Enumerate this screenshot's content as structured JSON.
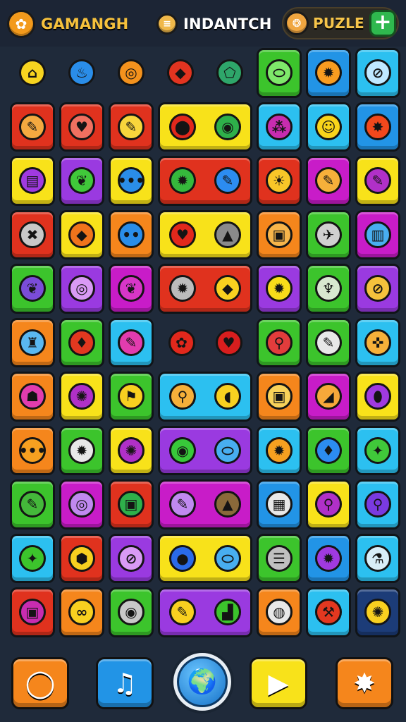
{
  "hud": {
    "item1": {
      "label": "GAMANGH",
      "icon": "gear-badge-icon",
      "color": "#f39a1c"
    },
    "item2": {
      "label": "INDANTCH",
      "icon": "coin-stack-icon",
      "color": "#f0b84a"
    },
    "item3": {
      "label": "PUZLE",
      "icon": "cookie-icon",
      "color": "#f0a640"
    },
    "plus": {
      "label": "+",
      "icon": "plus-icon"
    }
  },
  "palette": {
    "red": "#e0321e",
    "orange": "#f5861c",
    "yellow": "#f8e21a",
    "green": "#3cc42c",
    "blue": "#2294e6",
    "cyan": "#2cc0f0",
    "purple": "#9a3ae0",
    "magenta": "#c81cc8"
  },
  "tiles": [
    [
      {
        "bg": "bare",
        "icon": "house-icon",
        "g": "⌂",
        "c": "#f7d420"
      },
      {
        "bg": "bare",
        "icon": "flame-icon",
        "g": "♨",
        "c": "#2a8de8"
      },
      {
        "bg": "bare",
        "icon": "chat-bubble-icon",
        "g": "◎",
        "c": "#f4921d"
      },
      {
        "bg": "bare",
        "icon": "diamond-icon",
        "g": "◆",
        "c": "#e23420"
      },
      {
        "bg": "bare",
        "icon": "pentagon-icon",
        "g": "⬠",
        "c": "#2ea66a"
      },
      {
        "bg": "green",
        "icon": "capsule-icon",
        "g": "⬭",
        "c": "#7ee86a"
      },
      {
        "bg": "blue",
        "icon": "gear-icon",
        "g": "✹",
        "c": "#f89c20"
      },
      {
        "bg": "cyan",
        "icon": "compass-icon",
        "g": "⊘",
        "c": "#bfe8ff"
      }
    ],
    [
      {
        "bg": "red",
        "icon": "pin-icon",
        "g": "✎",
        "c": "#f4a940"
      },
      {
        "bg": "red",
        "icon": "heart-badge-icon",
        "g": "♥",
        "c": "#f07060"
      },
      {
        "bg": "red",
        "icon": "pencil-icon",
        "g": "✎",
        "c": "#f8d63c"
      },
      {
        "bg": "yellow",
        "span": 2,
        "icons": [
          {
            "icon": "location-pin-icon",
            "g": "⬤",
            "c": "#e2281c"
          },
          {
            "icon": "message-icon",
            "g": "◉",
            "c": "#2eb04a"
          }
        ]
      },
      {
        "bg": "cyan",
        "icon": "people-icon",
        "g": "⁂",
        "c": "#c82cb0"
      },
      {
        "bg": "cyan",
        "icon": "smile-icon",
        "g": "☺",
        "c": "#f8d41a"
      },
      {
        "bg": "blue",
        "icon": "starburst-icon",
        "g": "✸",
        "c": "#f2481c"
      }
    ],
    [
      {
        "bg": "yellow",
        "icon": "bandage-icon",
        "g": "▤",
        "c": "#a03ae0"
      },
      {
        "bg": "purple",
        "icon": "leaf-icon",
        "g": "❦",
        "c": "#40c83a"
      },
      {
        "bg": "yellow",
        "icon": "dots-icon",
        "g": "•••",
        "c": "#2a8de8"
      },
      {
        "bg": "red",
        "span": 2,
        "icons": [
          {
            "icon": "cog-icon",
            "g": "✹",
            "c": "#36b83c"
          },
          {
            "icon": "paint-tube-icon",
            "g": "✎",
            "c": "#2c8cf0"
          }
        ]
      },
      {
        "bg": "red",
        "icon": "robot-icon",
        "g": "☀",
        "c": "#f8c628"
      },
      {
        "bg": "magenta",
        "icon": "crayon-icon",
        "g": "✎",
        "c": "#f6b03a"
      },
      {
        "bg": "yellow",
        "icon": "marker-icon",
        "g": "✎",
        "c": "#b030c8"
      }
    ],
    [
      {
        "bg": "red",
        "icon": "cross-tools-icon",
        "g": "✖",
        "c": "#c8c8c8"
      },
      {
        "bg": "yellow",
        "icon": "eraser-icon",
        "g": "◆",
        "c": "#f0741c"
      },
      {
        "bg": "orange",
        "icon": "face-icon",
        "g": "••",
        "c": "#2a8de8"
      },
      {
        "bg": "yellow",
        "span": 2,
        "icons": [
          {
            "icon": "heart-icon",
            "g": "♥",
            "c": "#e2281c"
          },
          {
            "icon": "triangle-icon",
            "g": "▲",
            "c": "#8a8a8a"
          }
        ]
      },
      {
        "bg": "orange",
        "icon": "cassette-icon",
        "g": "▣",
        "c": "#f6b44a"
      },
      {
        "bg": "green",
        "icon": "rocket-icon",
        "g": "✈",
        "c": "#d0d0d0"
      },
      {
        "bg": "magenta",
        "icon": "printer-icon",
        "g": "▥",
        "c": "#48aef0"
      }
    ],
    [
      {
        "bg": "green",
        "icon": "feather-icon",
        "g": "❦",
        "c": "#7a4cd8"
      },
      {
        "bg": "purple",
        "icon": "ring-icon",
        "g": "◎",
        "c": "#d99af5"
      },
      {
        "bg": "magenta",
        "icon": "plume-icon",
        "g": "❦",
        "c": "#d836c8"
      },
      {
        "bg": "red",
        "span": 2,
        "icons": [
          {
            "icon": "gear-outline-icon",
            "g": "✹",
            "c": "#bcbcbc"
          },
          {
            "icon": "tag-icon",
            "g": "◆",
            "c": "#f8d020"
          }
        ]
      },
      {
        "bg": "purple",
        "icon": "sun-gear-icon",
        "g": "✹",
        "c": "#f8dc1a"
      },
      {
        "bg": "green",
        "icon": "totem-icon",
        "g": "♆",
        "c": "#d8e8d0"
      },
      {
        "bg": "purple",
        "icon": "no-pencil-icon",
        "g": "⊘",
        "c": "#f4c23c"
      }
    ],
    [
      {
        "bg": "orange",
        "icon": "jar-icon",
        "g": "♜",
        "c": "#5ab8f0"
      },
      {
        "bg": "green",
        "icon": "ice-cream-icon",
        "g": "♦",
        "c": "#e23820"
      },
      {
        "bg": "cyan",
        "icon": "crayon-pink-icon",
        "g": "✎",
        "c": "#e23cae"
      },
      {
        "bg": "bare",
        "span": 2,
        "icons": [
          {
            "icon": "flower-icon",
            "g": "✿",
            "c": "#e2281c"
          },
          {
            "icon": "heart-icon",
            "g": "♥",
            "c": "#d81e1e"
          }
        ]
      },
      {
        "bg": "green",
        "icon": "lollipop-icon",
        "g": "⚲",
        "c": "#e23c3c"
      },
      {
        "bg": "green",
        "icon": "pen-icon",
        "g": "✎",
        "c": "#e8e8e8"
      },
      {
        "bg": "cyan",
        "icon": "joint-icon",
        "g": "✜",
        "c": "#f6b03a"
      }
    ],
    [
      {
        "bg": "orange",
        "icon": "blob-icon",
        "g": "☗",
        "c": "#e23cae"
      },
      {
        "bg": "yellow",
        "icon": "burst-icon",
        "g": "✺",
        "c": "#b030c8"
      },
      {
        "bg": "green",
        "icon": "trumpet-icon",
        "g": "⚑",
        "c": "#f8d020"
      },
      {
        "bg": "cyan",
        "span": 2,
        "icons": [
          {
            "icon": "balloon-icon",
            "g": "⚲",
            "c": "#f6b03a"
          },
          {
            "icon": "bell-icon",
            "g": "◖",
            "c": "#f8d020"
          }
        ]
      },
      {
        "bg": "orange",
        "icon": "radio-icon",
        "g": "▣",
        "c": "#f8d25a"
      },
      {
        "bg": "magenta",
        "icon": "ruler-icon",
        "g": "◢",
        "c": "#f6a83a"
      },
      {
        "bg": "yellow",
        "icon": "eggplant-icon",
        "g": "⬮",
        "c": "#a03ae0"
      }
    ],
    [
      {
        "bg": "orange",
        "icon": "dots-face-icon",
        "g": "•••",
        "c": "#f6a020"
      },
      {
        "bg": "green",
        "icon": "gear-white-icon",
        "g": "✹",
        "c": "#e8e8e8"
      },
      {
        "bg": "yellow",
        "icon": "badge-icon",
        "g": "✺",
        "c": "#b030c8"
      },
      {
        "bg": "purple",
        "span": 2,
        "icons": [
          {
            "icon": "chat-green-icon",
            "g": "◉",
            "c": "#38c83a"
          },
          {
            "icon": "pill-icon",
            "g": "⬭",
            "c": "#48aef0"
          }
        ]
      },
      {
        "bg": "cyan",
        "icon": "sun-icon",
        "g": "✹",
        "c": "#f6a020"
      },
      {
        "bg": "green",
        "icon": "cone-icon",
        "g": "♦",
        "c": "#2c8cf0"
      },
      {
        "bg": "cyan",
        "icon": "microbe-icon",
        "g": "✦",
        "c": "#40c83a"
      }
    ],
    [
      {
        "bg": "green",
        "icon": "brush-icon",
        "g": "✎",
        "c": "#44b83a"
      },
      {
        "bg": "magenta",
        "icon": "o-ring-icon",
        "g": "◎",
        "c": "#c089f0"
      },
      {
        "bg": "red",
        "icon": "basket-icon",
        "g": "▣",
        "c": "#2eb04a"
      },
      {
        "bg": "magenta",
        "span": 2,
        "icons": [
          {
            "icon": "glue-icon",
            "g": "✎",
            "c": "#c089f0"
          },
          {
            "icon": "mountain-icon",
            "g": "▲",
            "c": "#8a6a3a"
          }
        ]
      },
      {
        "bg": "blue",
        "icon": "phone-icon",
        "g": "▦",
        "c": "#e8e8e8"
      },
      {
        "bg": "yellow",
        "icon": "lollipop-pair-icon",
        "g": "⚲",
        "c": "#b030c8"
      },
      {
        "bg": "cyan",
        "icon": "wand-icon",
        "g": "⚲",
        "c": "#7a3ae0"
      }
    ],
    [
      {
        "bg": "cyan",
        "icon": "splat-icon",
        "g": "✦",
        "c": "#3cc42c"
      },
      {
        "bg": "red",
        "icon": "nut-icon",
        "g": "⬢",
        "c": "#f8d020"
      },
      {
        "bg": "purple",
        "icon": "no-lightning-icon",
        "g": "⊘",
        "c": "#d99af5"
      },
      {
        "bg": "yellow",
        "span": 2,
        "icons": [
          {
            "icon": "berry-icon",
            "g": "●",
            "c": "#2a6ae8"
          },
          {
            "icon": "capsule-blue-icon",
            "g": "⬭",
            "c": "#48aef0"
          }
        ]
      },
      {
        "bg": "green",
        "icon": "list-icon",
        "g": "☰",
        "c": "#c0c0c0"
      },
      {
        "bg": "blue",
        "icon": "gear-purple-icon",
        "g": "✹",
        "c": "#a03ae0"
      },
      {
        "bg": "cyan",
        "icon": "syringe-icon",
        "g": "⚗",
        "c": "#d8eef8"
      }
    ],
    [
      {
        "bg": "red",
        "icon": "camera-icon",
        "g": "▣",
        "c": "#c82cb0"
      },
      {
        "bg": "orange",
        "icon": "link-icon",
        "g": "∞",
        "c": "#f8d020"
      },
      {
        "bg": "green",
        "icon": "chat-dots-icon",
        "g": "◉",
        "c": "#c8c8c8"
      },
      {
        "bg": "purple",
        "span": 2,
        "icons": [
          {
            "icon": "pencil-yellow-icon",
            "g": "✎",
            "c": "#f8d020"
          },
          {
            "icon": "stairs-icon",
            "g": "▟",
            "c": "#3cc42c"
          }
        ]
      },
      {
        "bg": "orange",
        "icon": "plate-icon",
        "g": "◍",
        "c": "#e8e8e8"
      },
      {
        "bg": "cyan",
        "icon": "hammer-icon",
        "g": "⚒",
        "c": "#e23820"
      },
      {
        "bg": "navy",
        "icon": "bug-icon",
        "g": "✺",
        "c": "#f8d020"
      }
    ]
  ],
  "bottom": [
    {
      "name": "search-button",
      "icon": "magnifier-icon",
      "g": "◯",
      "bg": "#f5861c"
    },
    {
      "name": "music-button",
      "icon": "music-note-icon",
      "g": "♫",
      "bg": "#2294e6"
    },
    {
      "name": "play-button",
      "icon": "play-icon",
      "g": "▶",
      "bg": "#f8e21a"
    },
    {
      "name": "settings-button",
      "icon": "sun-badge-icon",
      "g": "✸",
      "bg": "#f5861c"
    }
  ],
  "globe": {
    "icon": "globe-icon",
    "g": "🌍"
  }
}
